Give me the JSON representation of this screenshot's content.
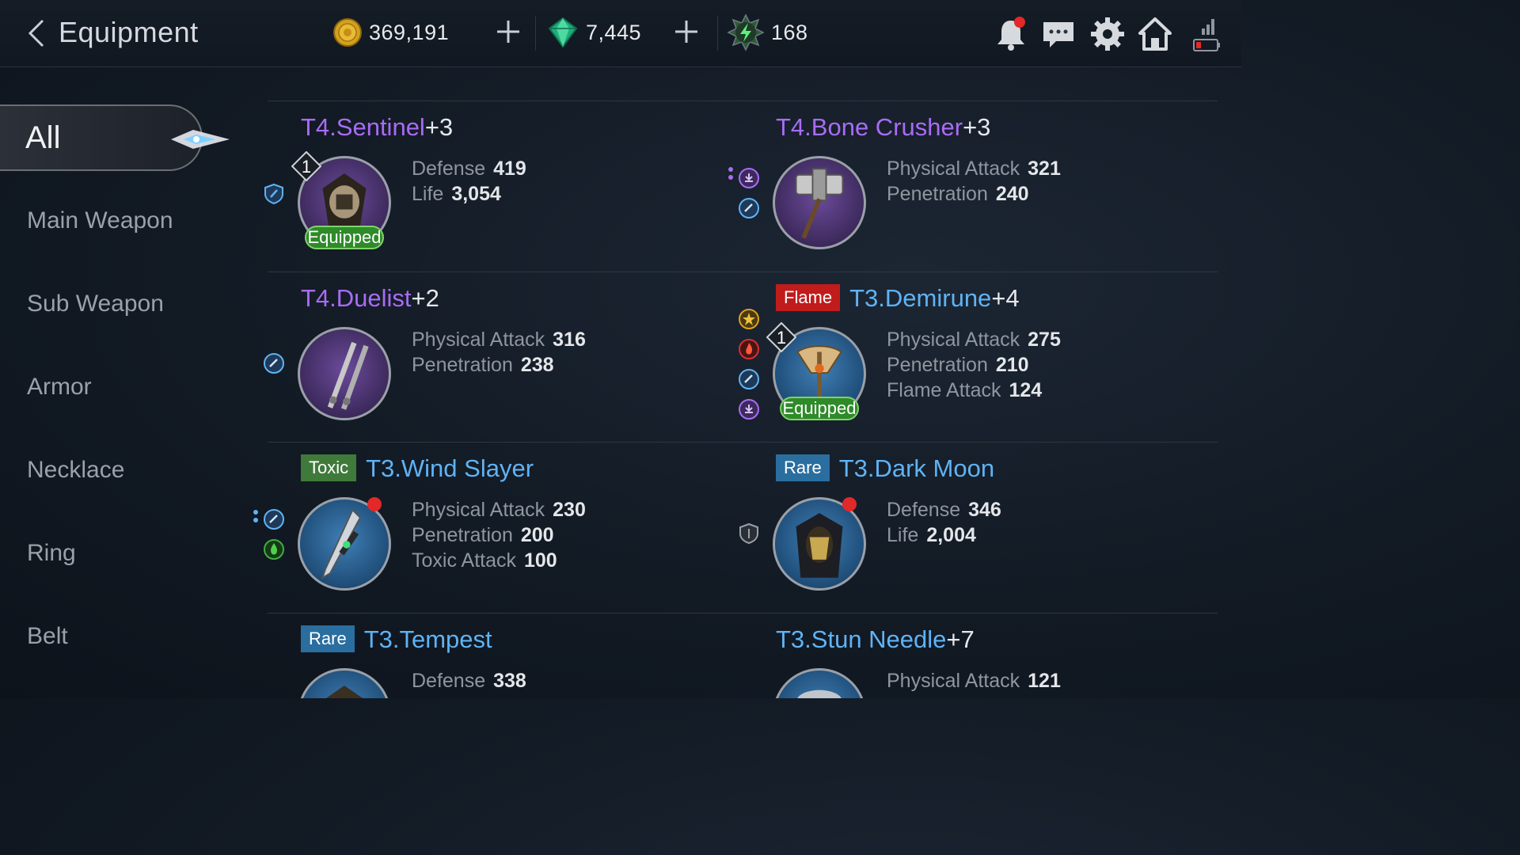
{
  "header": {
    "title": "Equipment",
    "gold": "369,191",
    "gems": "7,445",
    "energy": "168"
  },
  "sidebar": {
    "items": [
      {
        "label": "All",
        "active": true
      },
      {
        "label": "Main Weapon"
      },
      {
        "label": "Sub Weapon"
      },
      {
        "label": "Armor"
      },
      {
        "label": "Necklace"
      },
      {
        "label": "Ring"
      },
      {
        "label": "Belt"
      }
    ]
  },
  "items": [
    {
      "name": "T4.Sentinel",
      "plus": "+3",
      "grade": "purple",
      "level": "1",
      "equipped": "Equipped",
      "stats": [
        {
          "k": "Defense",
          "v": "419"
        },
        {
          "k": "Life",
          "v": "3,054"
        }
      ]
    },
    {
      "name": "T4.Bone Crusher",
      "plus": "+3",
      "grade": "purple",
      "stats": [
        {
          "k": "Physical Attack",
          "v": "321"
        },
        {
          "k": "Penetration",
          "v": "240"
        }
      ]
    },
    {
      "name": "T4.Duelist",
      "plus": "+2",
      "grade": "purple",
      "stats": [
        {
          "k": "Physical Attack",
          "v": "316"
        },
        {
          "k": "Penetration",
          "v": "238"
        }
      ]
    },
    {
      "tag": "Flame",
      "name": "T3.Demirune",
      "plus": "+4",
      "grade": "blue",
      "level": "1",
      "equipped": "Equipped",
      "stats": [
        {
          "k": "Physical Attack",
          "v": "275"
        },
        {
          "k": "Penetration",
          "v": "210"
        },
        {
          "k": "Flame Attack",
          "v": "124"
        }
      ]
    },
    {
      "tag": "Toxic",
      "name": "T3.Wind Slayer",
      "plus": "",
      "grade": "blue",
      "stats": [
        {
          "k": "Physical Attack",
          "v": "230"
        },
        {
          "k": "Penetration",
          "v": "200"
        },
        {
          "k": "Toxic Attack",
          "v": "100"
        }
      ]
    },
    {
      "tag": "Rare",
      "name": "T3.Dark Moon",
      "plus": "",
      "grade": "blue",
      "stats": [
        {
          "k": "Defense",
          "v": "346"
        },
        {
          "k": "Life",
          "v": "2,004"
        }
      ]
    },
    {
      "tag": "Rare",
      "name": "T3.Tempest",
      "plus": "",
      "grade": "blue",
      "stats": [
        {
          "k": "Defense",
          "v": "338"
        }
      ]
    },
    {
      "name": "T3.Stun Needle",
      "plus": "+7",
      "grade": "blue",
      "stats": [
        {
          "k": "Physical Attack",
          "v": "121"
        }
      ]
    }
  ],
  "colors": {
    "purple_grade": "#a86cf5",
    "blue_grade": "#5fb3f5",
    "equipped": "#2f8a2a",
    "flame": "#c01c1c",
    "toxic": "#3f7a3a",
    "rare": "#2a6ea0"
  }
}
